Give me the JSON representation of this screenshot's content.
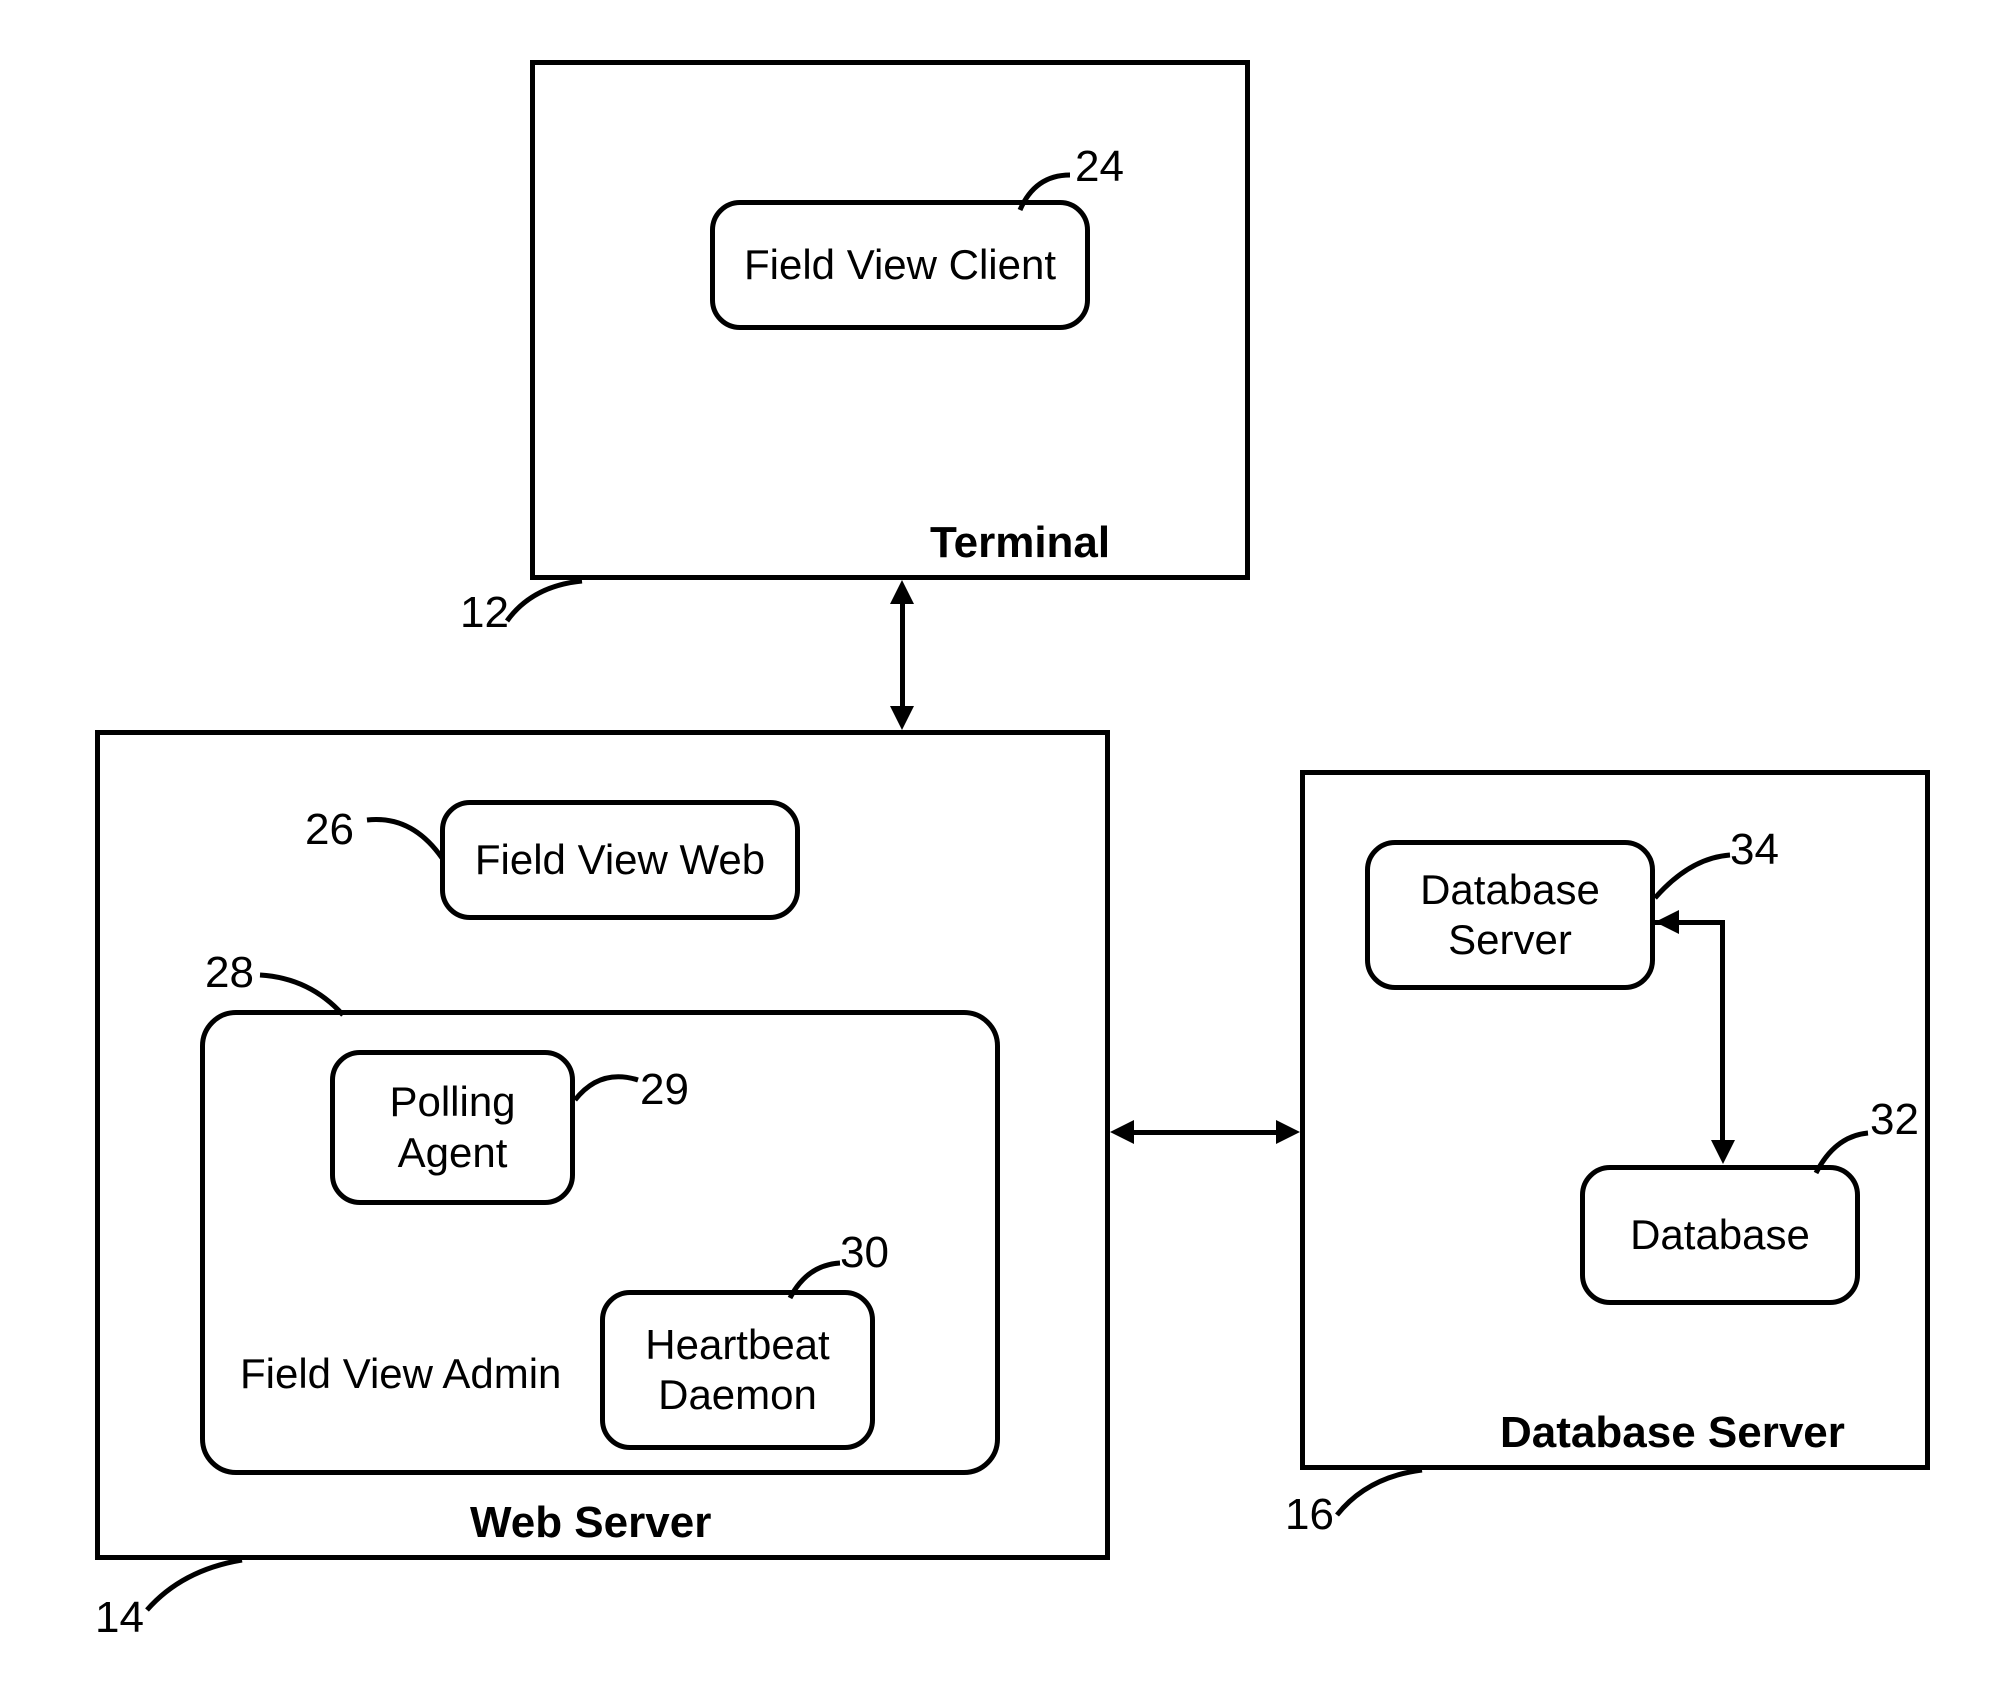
{
  "terminal": {
    "title": "Terminal",
    "ref": "12",
    "field_view_client": {
      "label": "Field View Client",
      "ref": "24"
    }
  },
  "web_server": {
    "title": "Web Server",
    "ref": "14",
    "field_view_web": {
      "label": "Field View Web",
      "ref": "26"
    },
    "field_view_admin": {
      "label": "Field View Admin",
      "ref": "28",
      "polling_agent": {
        "label": "Polling\nAgent",
        "ref": "29"
      },
      "heartbeat_daemon": {
        "label": "Heartbeat\nDaemon",
        "ref": "30"
      }
    }
  },
  "database_server": {
    "title": "Database Server",
    "ref": "16",
    "db_server_comp": {
      "label": "Database\nServer",
      "ref": "34"
    },
    "database": {
      "label": "Database",
      "ref": "32"
    }
  }
}
